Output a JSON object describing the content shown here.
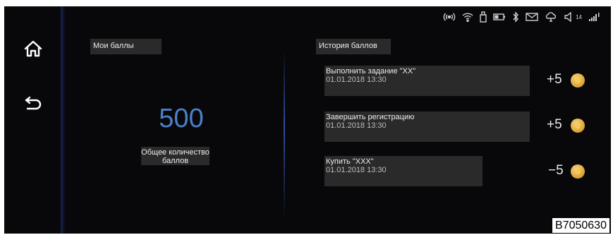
{
  "status_bar": {
    "icons": [
      "radio-signal-icon",
      "wifi-icon",
      "usb-icon",
      "battery-icon",
      "bluetooth-icon",
      "mail-icon",
      "cloud-icon",
      "volume-icon",
      "cellular-signal-icon"
    ],
    "volume_level": "14"
  },
  "nav": {
    "items": [
      "home-icon",
      "back-icon"
    ]
  },
  "my_points": {
    "title": "Мои баллы",
    "total": "500",
    "total_label": "Общее количество баллов"
  },
  "history": {
    "title": "История баллов",
    "items": [
      {
        "title": "Выполнить задание \"XX\"",
        "date": "01.01.2018 13:30",
        "points": "+5"
      },
      {
        "title": "Завершить регистрацию",
        "date": "01.01.2018 13:30",
        "points": "+5"
      },
      {
        "title": "Купить \"XXX\"",
        "date": "01.01.2018 13:30",
        "points": "−5"
      }
    ]
  },
  "image_code": "B7050630",
  "colors": {
    "background": "#08080b",
    "accent_blue": "#4a80c8",
    "label_bg": "#2a2a2a",
    "coin": "#e0a93b"
  }
}
